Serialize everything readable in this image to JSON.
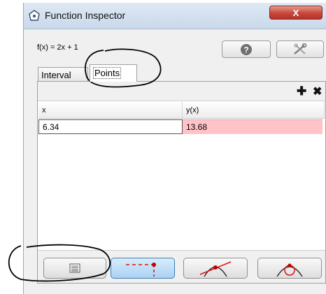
{
  "window": {
    "title": "Function Inspector",
    "close_label": "X"
  },
  "function": {
    "expression": "f(x) = 2x + 1"
  },
  "toolbar": {
    "help_icon": "help-icon",
    "settings_icon": "tools-icon"
  },
  "tabs": [
    {
      "label": "Interval",
      "selected": false
    },
    {
      "label": "Points",
      "selected": true
    }
  ],
  "points_panel": {
    "add_icon": "plus-icon",
    "remove_icon": "x-icon",
    "columns": [
      "x",
      "y(x)"
    ],
    "rows": [
      {
        "x": "6.34",
        "y": "13.68"
      }
    ]
  },
  "mode_buttons": [
    {
      "icon": "table-icon",
      "selected": false
    },
    {
      "icon": "trace-point-icon",
      "selected": true
    },
    {
      "icon": "tangent-icon",
      "selected": false
    },
    {
      "icon": "osculating-circle-icon",
      "selected": false
    }
  ],
  "colors": {
    "highlight_cell": "#ffc3c8",
    "selected_button": "#a9d2f3",
    "close_button": "#c8463a"
  }
}
